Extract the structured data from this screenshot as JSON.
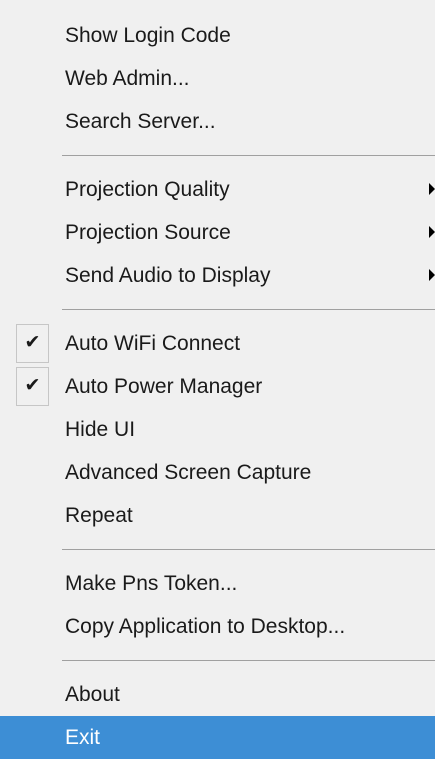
{
  "menu": {
    "groups": [
      {
        "items": [
          {
            "label": "Show Login Code",
            "checked": false,
            "submenu": false
          },
          {
            "label": "Web Admin...",
            "checked": false,
            "submenu": false
          },
          {
            "label": "Search Server...",
            "checked": false,
            "submenu": false
          }
        ]
      },
      {
        "items": [
          {
            "label": "Projection Quality",
            "checked": false,
            "submenu": true
          },
          {
            "label": "Projection Source",
            "checked": false,
            "submenu": true
          },
          {
            "label": "Send Audio to Display",
            "checked": false,
            "submenu": true
          }
        ]
      },
      {
        "items": [
          {
            "label": "Auto WiFi Connect",
            "checked": true,
            "submenu": false
          },
          {
            "label": "Auto Power Manager",
            "checked": true,
            "submenu": false
          },
          {
            "label": "Hide UI",
            "checked": false,
            "submenu": false
          },
          {
            "label": "Advanced Screen Capture",
            "checked": false,
            "submenu": false
          },
          {
            "label": "Repeat",
            "checked": false,
            "submenu": false
          }
        ]
      },
      {
        "items": [
          {
            "label": "Make Pns Token...",
            "checked": false,
            "submenu": false
          },
          {
            "label": "Copy Application to Desktop...",
            "checked": false,
            "submenu": false
          }
        ]
      },
      {
        "items": [
          {
            "label": "About",
            "checked": false,
            "submenu": false
          },
          {
            "label": "Exit",
            "checked": false,
            "submenu": false,
            "highlighted": true
          }
        ]
      }
    ],
    "check_glyph": "✔",
    "colors": {
      "background": "#f0f0f0",
      "text": "#1a1a1a",
      "separator": "#a0a0a0",
      "highlight": "#3d8ed5",
      "highlight_text": "#ffffff"
    }
  }
}
